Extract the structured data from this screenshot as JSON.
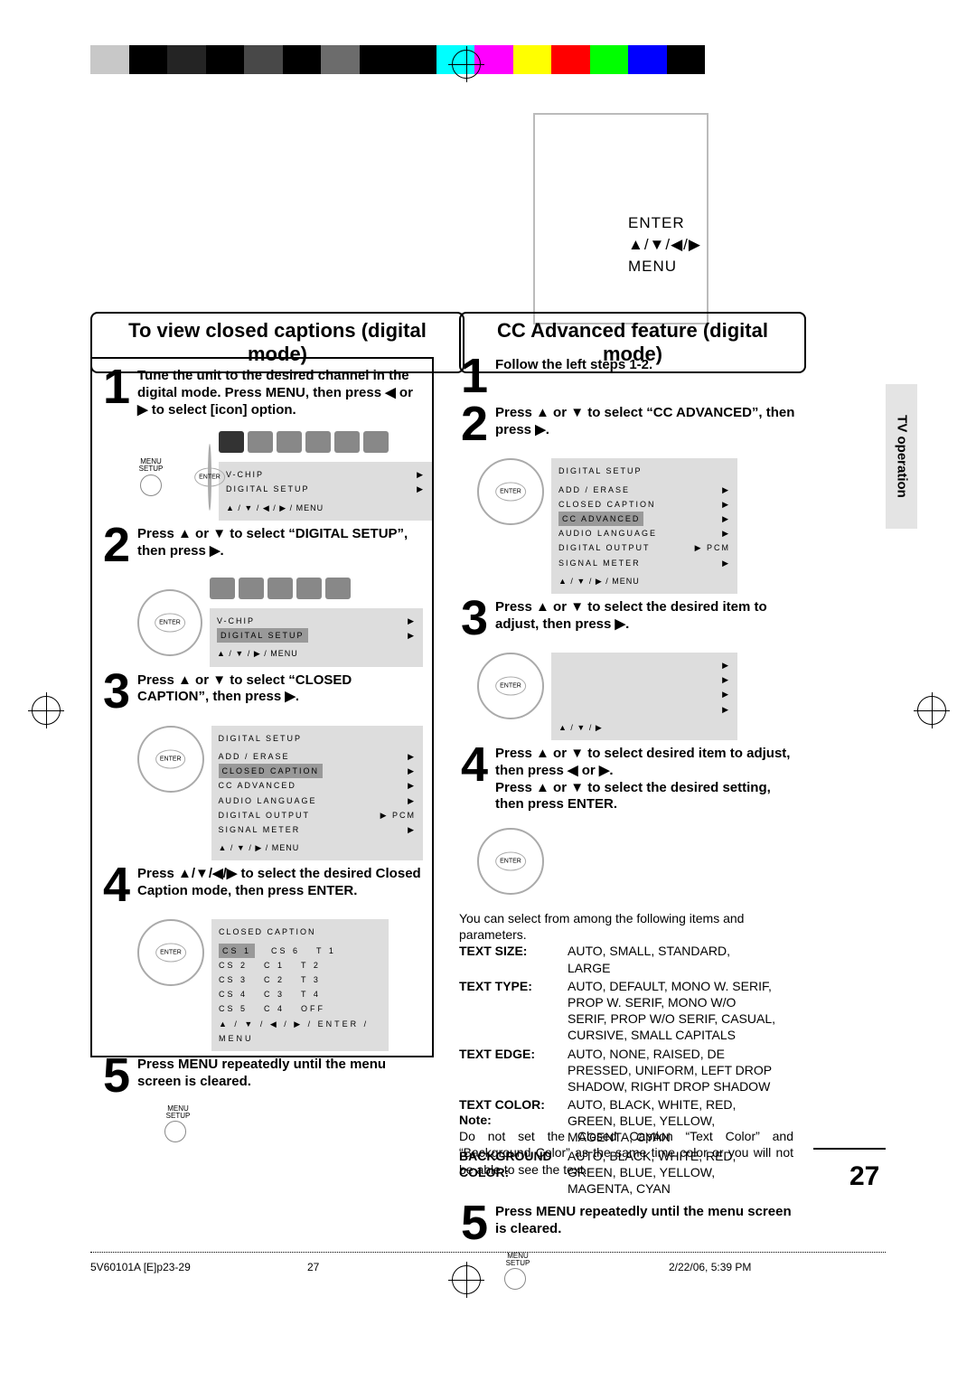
{
  "colorbar": [
    "#c8c8c8",
    "#000",
    "#242424",
    "#000",
    "#484848",
    "#000",
    "#6c6c6c",
    "#000",
    "#000",
    "#00ffff",
    "#ff00ff",
    "#ffff00",
    "#ff0000",
    "#00ff00",
    "#0000ff",
    "#000"
  ],
  "remote": {
    "enter": "ENTER",
    "arrows": "▲/▼/◀/▶",
    "menu": "MENU"
  },
  "titles": {
    "left": "To view closed captions (digital mode)",
    "right": "CC Advanced feature (digital mode)"
  },
  "sidetab": "TV operation",
  "left": {
    "s1": "Tune the unit to the desired channel in the digital mode. Press MENU, then press ◀ or ▶ to select [icon] option.",
    "s1_menusetup": "MENU\nSETUP",
    "panel1": {
      "rows": [
        [
          "V-CHIP",
          "▶"
        ],
        [
          "DIGITAL SETUP",
          "▶"
        ]
      ],
      "foot": "▲ / ▼ / ◀ / ▶ / MENU"
    },
    "s2": "Press ▲ or ▼ to select “DIGITAL SETUP”, then press ▶.",
    "panel2": {
      "rows": [
        [
          "V-CHIP",
          "▶"
        ],
        [
          "DIGITAL SETUP",
          "▶"
        ]
      ],
      "hl": 1,
      "foot": "▲ / ▼ / ▶ / MENU"
    },
    "s3": "Press ▲ or ▼ to select “CLOSED CAPTION”, then press ▶.",
    "panel3": {
      "title": "DIGITAL SETUP",
      "rows": [
        [
          "ADD / ERASE",
          "▶"
        ],
        [
          "CLOSED CAPTION",
          "▶"
        ],
        [
          "CC ADVANCED",
          "▶"
        ],
        [
          "AUDIO LANGUAGE",
          "▶"
        ],
        [
          "DIGITAL OUTPUT",
          "▶ PCM"
        ],
        [
          "SIGNAL METER",
          "▶"
        ]
      ],
      "hl": 1,
      "foot": "▲ / ▼ / ▶ / MENU"
    },
    "s4": "Press ▲/▼/◀/▶ to select the desired Closed Caption mode, then press ENTER.",
    "cc_table": {
      "title": "CLOSED CAPTION",
      "rows": [
        [
          "CS 1",
          "CS 6",
          "T 1"
        ],
        [
          "CS 2",
          "C 1",
          "T 2"
        ],
        [
          "CS 3",
          "C 2",
          "T 3"
        ],
        [
          "CS 4",
          "C 3",
          "T 4"
        ],
        [
          "CS 5",
          "C 4",
          "OFF"
        ]
      ],
      "hl_r": 0,
      "hl_c": 0,
      "foot": "▲ / ▼ / ◀ / ▶ / ENTER / MENU"
    },
    "s5": "Press MENU repeatedly until the menu screen is cleared."
  },
  "right": {
    "s1": "Follow the left steps 1-2.",
    "s2": "Press ▲ or ▼ to select “CC ADVANCED”, then press ▶.",
    "panel2": {
      "title": "DIGITAL SETUP",
      "rows": [
        [
          "ADD / ERASE",
          "▶"
        ],
        [
          "CLOSED CAPTION",
          "▶"
        ],
        [
          "CC ADVANCED",
          "▶"
        ],
        [
          "AUDIO LANGUAGE",
          "▶"
        ],
        [
          "DIGITAL OUTPUT",
          "▶ PCM"
        ],
        [
          "SIGNAL METER",
          "▶"
        ]
      ],
      "hl": 2,
      "foot": "▲ / ▼ / ▶ / MENU"
    },
    "s3": "Press ▲ or ▼ to select the desired item to adjust, then press ▶.",
    "panel3_rows": [
      "▶",
      "▶",
      "▶",
      "▶"
    ],
    "panel3_foot": "▲ / ▼ / ▶",
    "s4": "Press ▲ or ▼ to select desired item to adjust, then press ◀ or ▶.\nPress ▲ or ▼ to select the desired setting, then press ENTER.",
    "params_intro": "You can select from among the following items and parameters.",
    "params": [
      {
        "label": "TEXT SIZE:",
        "val": "AUTO, SMALL, STANDARD, LARGE"
      },
      {
        "label": "TEXT TYPE:",
        "val": "AUTO, DEFAULT, MONO W. SERIF, PROP W. SERIF, MONO W/O SERIF, PROP W/O SERIF, CASUAL, CURSIVE, SMALL CAPITALS"
      },
      {
        "label": "TEXT EDGE:",
        "val": "AUTO, NONE, RAISED, DE PRESSED, UNIFORM, LEFT DROP SHADOW, RIGHT DROP SHADOW"
      },
      {
        "label": "TEXT COLOR:",
        "val": "AUTO, BLACK, WHITE, RED, GREEN, BLUE, YELLOW, MAGENTA, CYAN"
      },
      {
        "label": "BACKGROUND COLOR:",
        "val": "AUTO, BLACK, WHITE, RED, GREEN, BLUE, YELLOW, MAGENTA, CYAN"
      }
    ],
    "s5": "Press MENU repeatedly until the menu screen is cleared."
  },
  "note": {
    "hd": "Note:",
    "body": "Do not set the Closed Caption “Text Color” and “Background Color” as the same time color or you will not be able to see the text."
  },
  "pagenum": "27",
  "footer": {
    "left": "5V60101A [E]p23-29",
    "center": "27",
    "right": "2/22/06, 5:39 PM"
  }
}
